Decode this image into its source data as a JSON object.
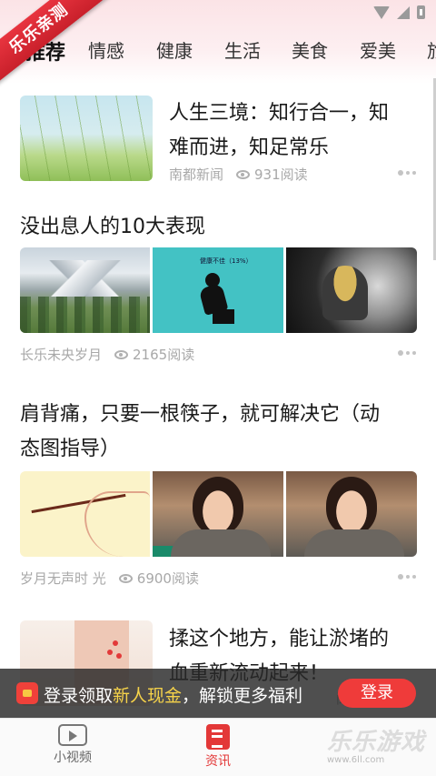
{
  "app": {
    "ribbon_text": "乐乐亲测",
    "accent_color": "#ef3b3a"
  },
  "status_bar": {
    "icons": [
      "wifi-icon",
      "signal-icon",
      "battery-icon"
    ]
  },
  "tabs": [
    {
      "label": "推荐",
      "active": true
    },
    {
      "label": "情感",
      "active": false
    },
    {
      "label": "健康",
      "active": false
    },
    {
      "label": "生活",
      "active": false
    },
    {
      "label": "美食",
      "active": false
    },
    {
      "label": "爱美",
      "active": false
    },
    {
      "label": "旅",
      "active": false
    }
  ],
  "articles": [
    {
      "title_line1": "人生三境：知行合一，知",
      "title_line2": "难而进，知足常乐",
      "source": "南都新闻",
      "reads": "931阅读"
    },
    {
      "title": "没出息人的10大表现",
      "source": "长乐未央岁月",
      "reads": "2165阅读",
      "image2_caption": "健康不佳（13%）"
    },
    {
      "title_line1": "肩背痛，只要一根筷子，就可解决它（动",
      "title_line2": "态图指导）",
      "source": "岁月无声时 光",
      "reads": "6900阅读"
    },
    {
      "title_line1": "揉这个地方，能让淤堵的",
      "title_line2": "血重新流动起来！",
      "reads": "阅读"
    }
  ],
  "banner": {
    "text_before": "登录领取",
    "text_highlight": "新人现金",
    "text_after": "，解锁更多福利",
    "login_label": "登录"
  },
  "bottom_nav": [
    {
      "label": "小视频",
      "icon": "video-icon",
      "active": false
    },
    {
      "label": "资讯",
      "icon": "news-icon",
      "active": true
    }
  ],
  "watermark": {
    "title": "乐乐游戏",
    "url": "www.6ll.com"
  }
}
